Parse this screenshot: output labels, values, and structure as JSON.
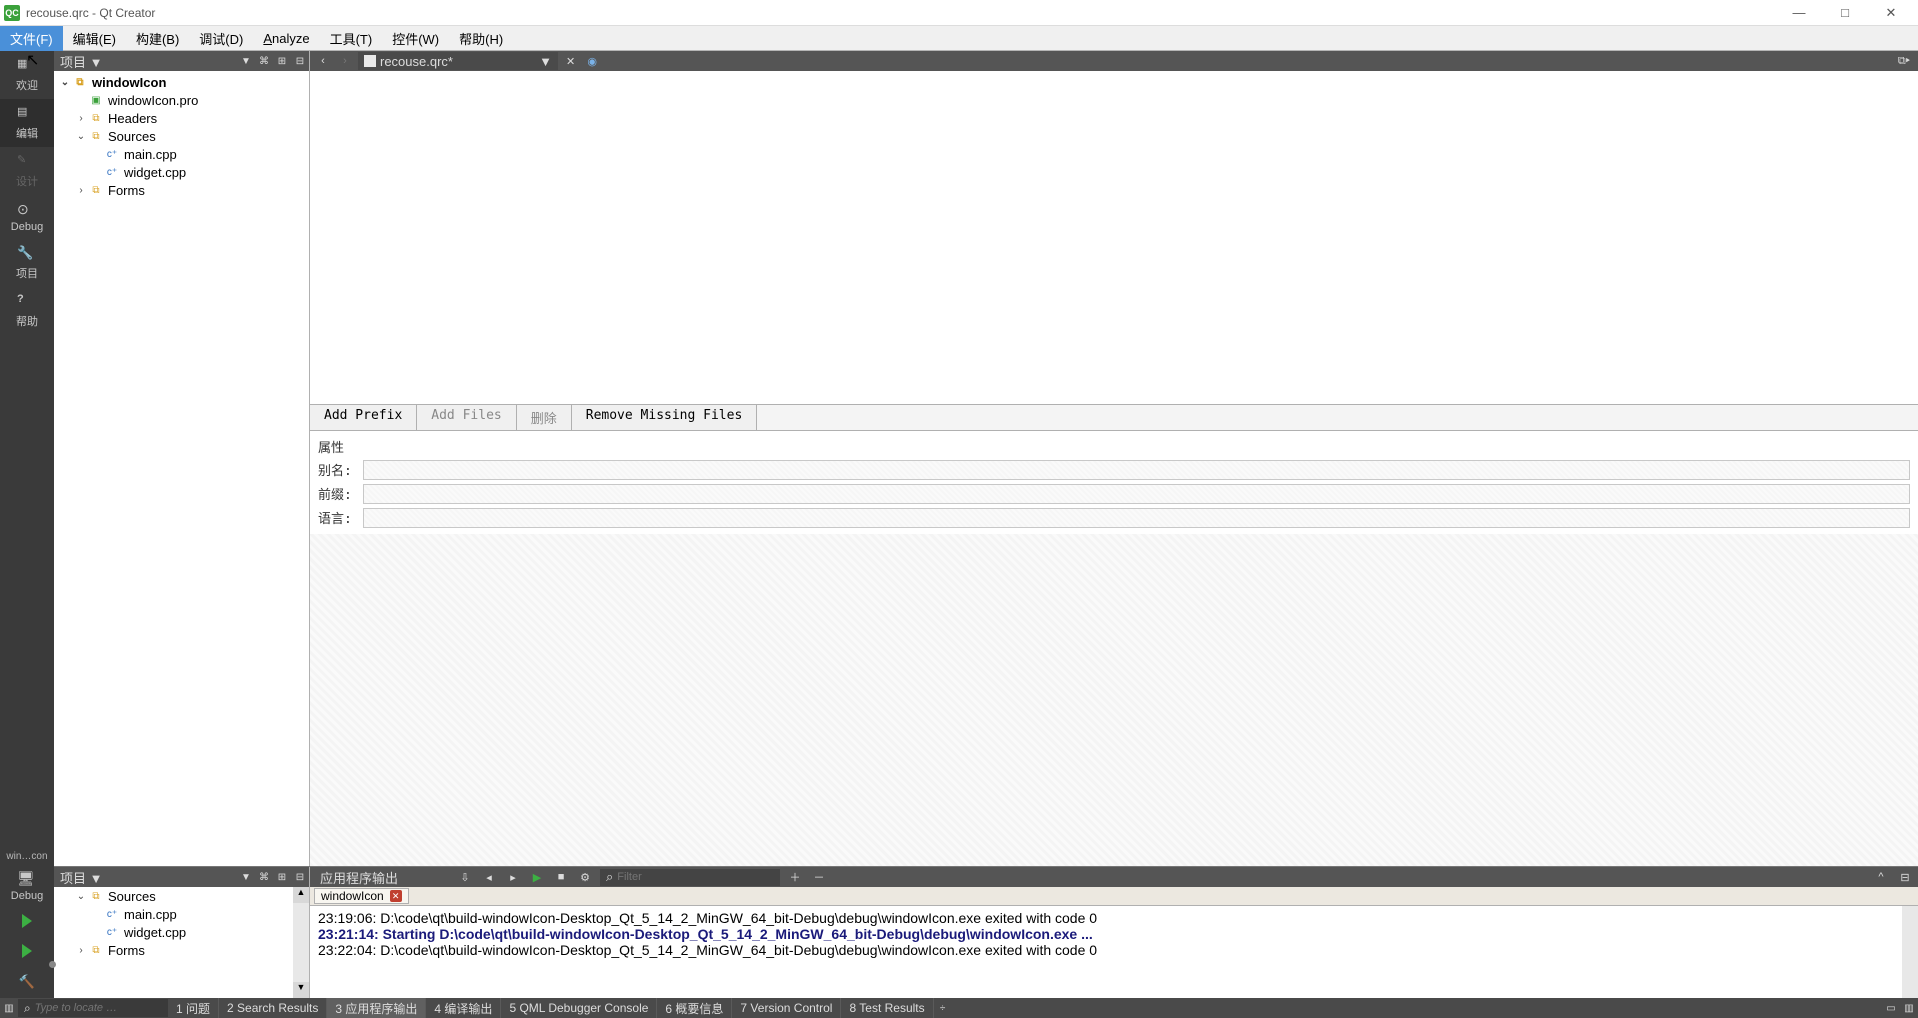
{
  "window": {
    "title": "recouse.qrc - Qt Creator",
    "app_badge": "QC"
  },
  "winbtns": {
    "min": "—",
    "max": "□",
    "close": "✕"
  },
  "menu": {
    "file": "文件(F)",
    "edit": "编辑(E)",
    "build": "构建(B)",
    "debug": "调试(D)",
    "analyze": "Analyze",
    "tools": "工具(T)",
    "widgets": "控件(W)",
    "help": "帮助(H)"
  },
  "modebar": {
    "welcome": "欢迎",
    "edit": "编辑",
    "design": "设计",
    "debug": "Debug",
    "projects": "项目",
    "help": "帮助",
    "kit_target": "win…con",
    "kit_config": "Debug"
  },
  "project_pane": {
    "header": "项目"
  },
  "tree": {
    "root": "windowIcon",
    "pro": "windowIcon.pro",
    "headers": "Headers",
    "sources": "Sources",
    "main_cpp": "main.cpp",
    "widget_cpp": "widget.cpp",
    "forms": "Forms"
  },
  "editor": {
    "open_doc": "recouse.qrc*"
  },
  "res_editor": {
    "add_prefix": "Add Prefix",
    "add_files": "Add Files",
    "delete": "删除",
    "remove_missing": "Remove Missing Files",
    "prop_title": "属性",
    "alias": "别名:",
    "prefix": "前缀:",
    "lang": "语言:"
  },
  "bottom_project_pane": {
    "header": "项目"
  },
  "output": {
    "title": "应用程序输出",
    "filter_placeholder": "Filter",
    "tab": "windowIcon",
    "lines": [
      "23:19:06: D:\\code\\qt\\build-windowIcon-Desktop_Qt_5_14_2_MinGW_64_bit-Debug\\debug\\windowIcon.exe exited with code 0",
      "",
      "23:21:14: Starting D:\\code\\qt\\build-windowIcon-Desktop_Qt_5_14_2_MinGW_64_bit-Debug\\debug\\windowIcon.exe ...",
      "23:22:04: D:\\code\\qt\\build-windowIcon-Desktop_Qt_5_14_2_MinGW_64_bit-Debug\\debug\\windowIcon.exe exited with code 0"
    ]
  },
  "status": {
    "locate_placeholder": "Type to locate …",
    "issues": "1 问题",
    "search": "2 Search Results",
    "app_out": "3 应用程序输出",
    "compile": "4 编译输出",
    "qml_dbg": "5 QML Debugger Console",
    "general": "6 概要信息",
    "vcs": "7 Version Control",
    "tests": "8 Test Results"
  }
}
